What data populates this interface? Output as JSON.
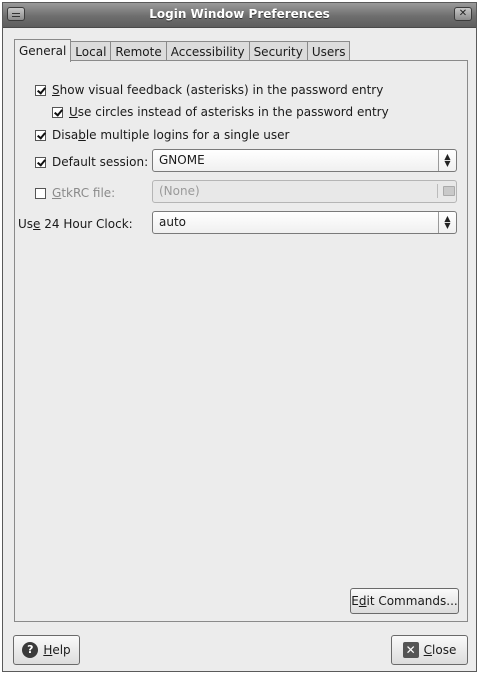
{
  "window": {
    "title": "Login Window Preferences"
  },
  "tabs": [
    {
      "label": "General"
    },
    {
      "label": "Local"
    },
    {
      "label": "Remote"
    },
    {
      "label": "Accessibility"
    },
    {
      "label": "Security"
    },
    {
      "label": "Users"
    }
  ],
  "general": {
    "show_feedback": {
      "key": "S",
      "rest": "how visual feedback (asterisks) in the password entry",
      "checked": true
    },
    "use_circles": {
      "key": "U",
      "rest": "se circles instead of asterisks in the password entry",
      "checked": true
    },
    "disable_multiple": {
      "pre": "Disa",
      "key": "b",
      "rest": "le multiple logins for a single user",
      "checked": true
    },
    "default_session": {
      "label": "Default session:",
      "checked": true,
      "value": "GNOME"
    },
    "gtkrc": {
      "key": "G",
      "rest": "tkRC file:",
      "checked": false,
      "value": "(None)"
    },
    "clock": {
      "pre": "Us",
      "key": "e",
      "rest": " 24 Hour Clock:",
      "value": "auto"
    }
  },
  "buttons": {
    "edit_commands": {
      "pre": "E",
      "key": "d",
      "rest": "it Commands..."
    },
    "help": {
      "key": "H",
      "rest": "elp"
    },
    "close": {
      "key": "C",
      "rest": "lose"
    }
  },
  "icons": [
    "window-menu-icon",
    "window-close-icon",
    "help-icon",
    "close-icon",
    "file-chooser-icon",
    "combo-arrow-icon"
  ]
}
